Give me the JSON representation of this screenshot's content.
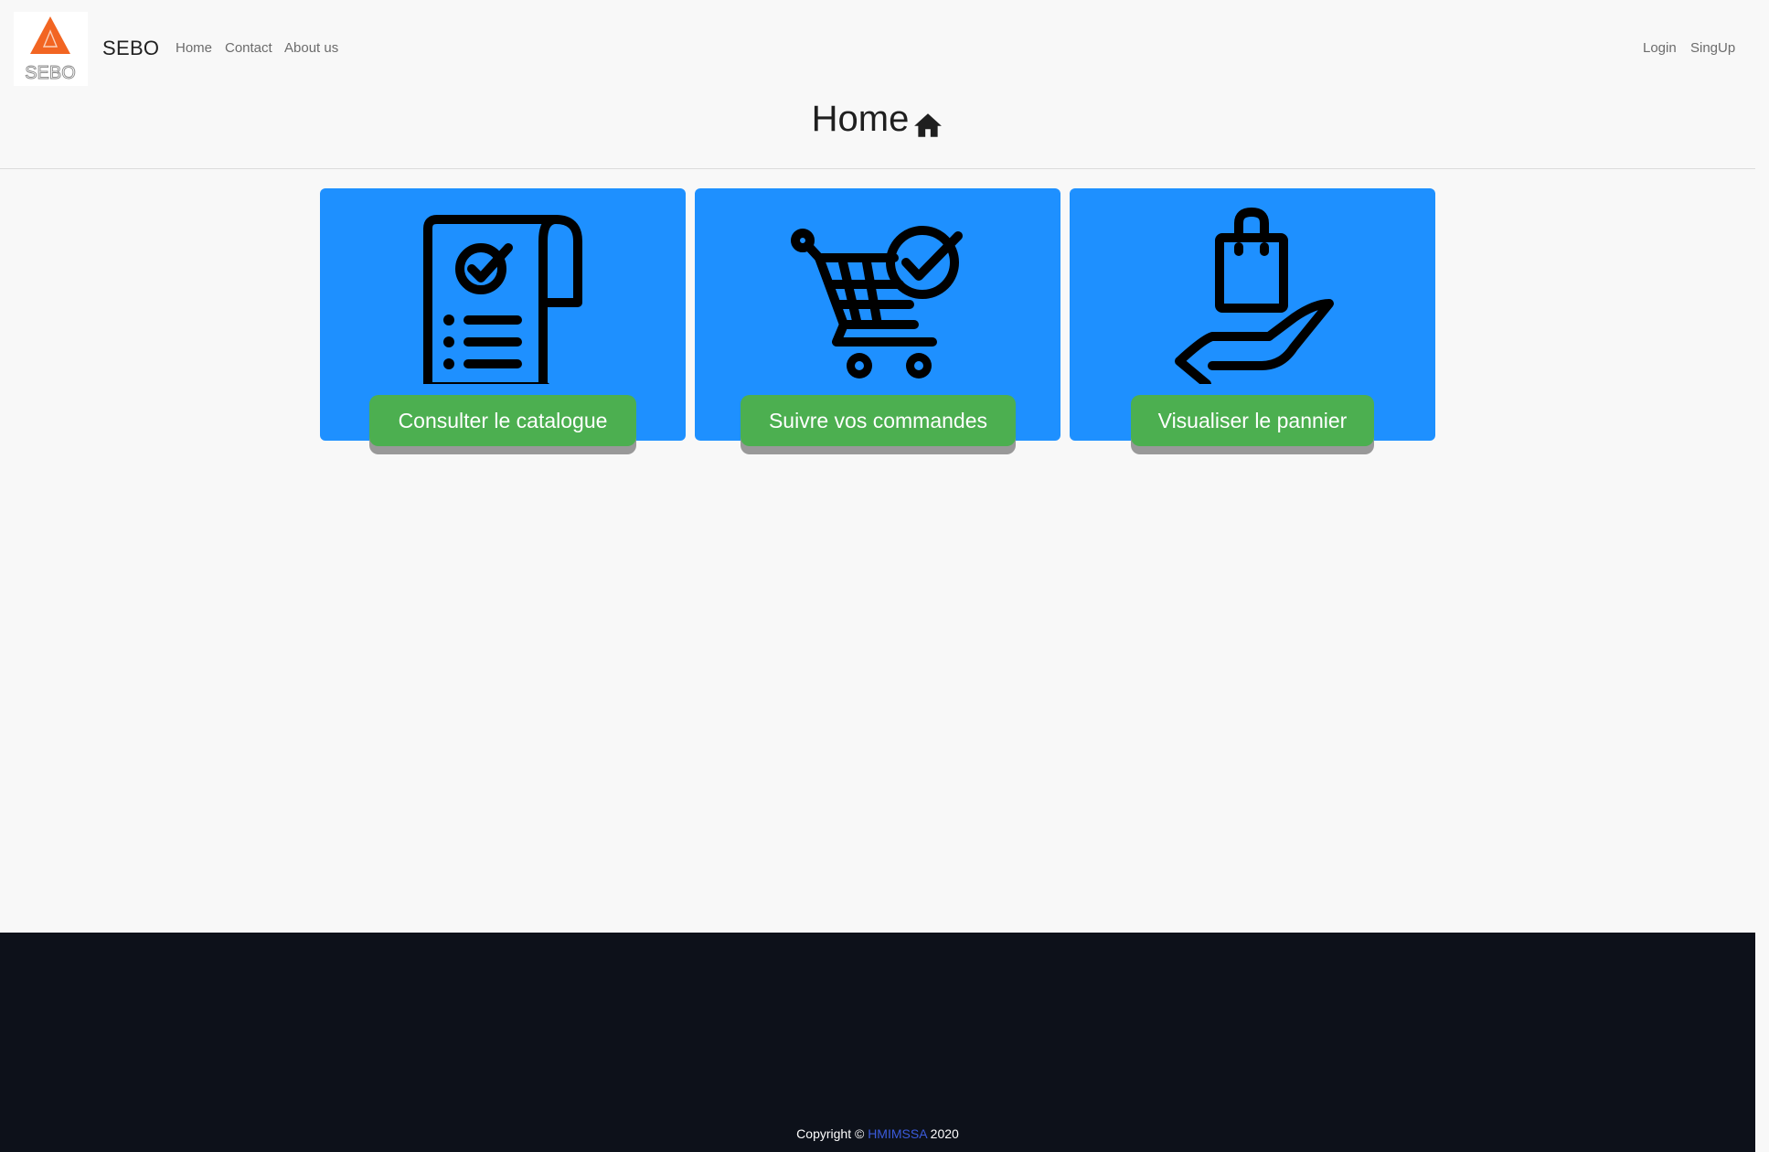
{
  "navbar": {
    "logo_text": "SEBO",
    "brand": "SEBO",
    "links": [
      "Home",
      "Contact",
      "About us"
    ],
    "auth_links": [
      "Login",
      "SingUp"
    ]
  },
  "page": {
    "title": "Home",
    "title_icon": "home-icon"
  },
  "cards": [
    {
      "icon": "receipt-checklist-icon",
      "button_label": "Consulter le catalogue"
    },
    {
      "icon": "shopping-cart-check-icon",
      "button_label": "Suivre vos commandes"
    },
    {
      "icon": "hand-holding-bag-icon",
      "button_label": "Visualiser le pannier"
    }
  ],
  "footer": {
    "copyright_prefix": "Copyright ©",
    "author": "HMIMSSA",
    "year": "2020"
  },
  "colors": {
    "background": "#f8f8f8",
    "card": "#1e90ff",
    "button": "#4caf50",
    "button_shadow": "#999999",
    "footer": "#0d111a",
    "logo_accent": "#f26522",
    "author_link": "#3b5bdb"
  }
}
